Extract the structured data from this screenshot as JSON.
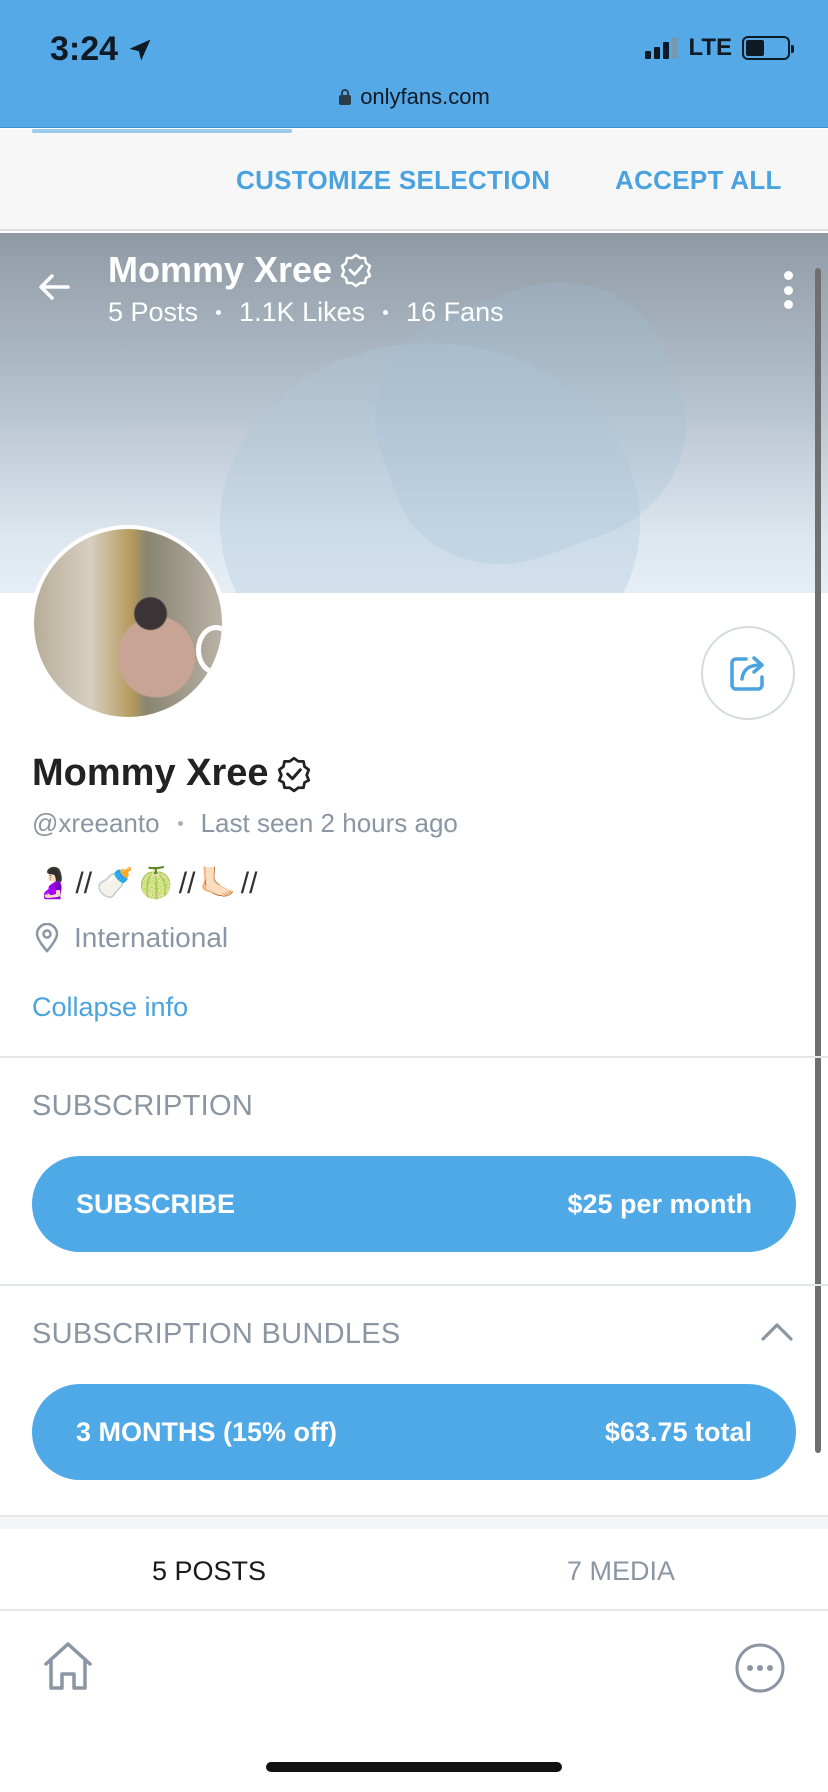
{
  "status_bar": {
    "time": "3:24",
    "network": "LTE"
  },
  "url_bar": {
    "domain": "onlyfans.com"
  },
  "cookie_banner": {
    "customize_label": "CUSTOMIZE SELECTION",
    "accept_label": "ACCEPT ALL"
  },
  "header": {
    "name": "Mommy Xree",
    "stats": {
      "posts": "5 Posts",
      "likes": "1.1K Likes",
      "fans": "16 Fans"
    }
  },
  "profile": {
    "name": "Mommy Xree",
    "handle": "@xreeanto",
    "last_seen": "Last seen 2 hours ago",
    "bio": {
      "e1": "🤰🏻",
      "sep1": "// ",
      "e2": "🍼",
      "e3": "🍈",
      "sep2": "// ",
      "e4": "🦶🏻",
      "sep3": " //"
    },
    "location": "International",
    "collapse_label": "Collapse info"
  },
  "subscription": {
    "title": "SUBSCRIPTION",
    "button_label": "SUBSCRIBE",
    "price": "$25 per month"
  },
  "bundles": {
    "title": "SUBSCRIPTION BUNDLES",
    "items": [
      {
        "label": "3 MONTHS (15% off)",
        "price": "$63.75 total"
      }
    ]
  },
  "tabs": {
    "posts": "5 POSTS",
    "media": "7 MEDIA"
  },
  "colors": {
    "accent": "#4ea9e6",
    "status_bar": "#55a9e6",
    "muted_text": "#8a96a3"
  },
  "icons": {
    "back": "arrow-left-icon",
    "more": "vertical-dots-icon",
    "share": "share-icon",
    "verified": "verified-badge-icon",
    "location": "location-pin-icon",
    "home": "home-icon",
    "more_bottom": "horizontal-dots-icon"
  }
}
